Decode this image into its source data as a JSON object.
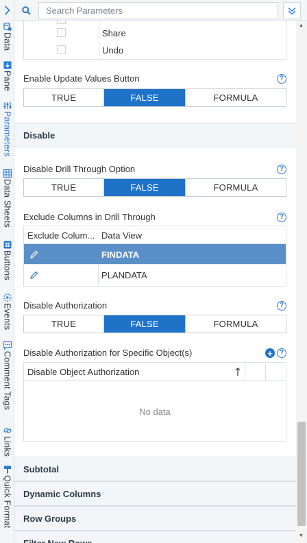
{
  "search": {
    "placeholder": "Search Parameters"
  },
  "vertical_tabs": [
    {
      "label": "Data",
      "icon": "database-icon"
    },
    {
      "label": "Pane",
      "icon": "pane-icon"
    },
    {
      "label": "Parameters",
      "icon": "sliders-icon"
    },
    {
      "label": "Data Sheets",
      "icon": "sheet-icon"
    },
    {
      "label": "Buttons",
      "icon": "buttons-icon"
    },
    {
      "label": "Events",
      "icon": "events-icon"
    },
    {
      "label": "Comment Tags",
      "icon": "comment-icon"
    },
    {
      "label": "Links",
      "icon": "link-icon"
    },
    {
      "label": "Quick Format",
      "icon": "format-icon"
    }
  ],
  "checklist": {
    "items": [
      "Share",
      "Undo"
    ]
  },
  "enable_update": {
    "label": "Enable Update Values Button",
    "options": [
      "TRUE",
      "FALSE",
      "FORMULA"
    ],
    "selected": "FALSE"
  },
  "sections": {
    "disable": "Disable",
    "subtotal": "Subtotal",
    "dynamic_columns": "Dynamic Columns",
    "row_groups": "Row Groups",
    "filter_new_rows": "Filter New Rows"
  },
  "disable_drill": {
    "label": "Disable Drill Through Option",
    "options": [
      "TRUE",
      "FALSE",
      "FORMULA"
    ],
    "selected": "FALSE"
  },
  "exclude_columns": {
    "label": "Exclude Columns in Drill Through",
    "headers": [
      "Exclude Colum...",
      "Data View"
    ],
    "rows": [
      {
        "data_view": "FINDATA",
        "selected": true
      },
      {
        "data_view": "PLANDATA",
        "selected": false
      }
    ]
  },
  "disable_auth": {
    "label": "Disable Authorization",
    "options": [
      "TRUE",
      "FALSE",
      "FORMULA"
    ],
    "selected": "FALSE"
  },
  "disable_auth_objects": {
    "label": "Disable Authorization for Specific Object(s)",
    "header": "Disable Object Authorization",
    "empty_text": "No data"
  },
  "help_glyph": "?",
  "colors": {
    "accent": "#1e73c9",
    "selected_row": "#5b8fc8"
  }
}
